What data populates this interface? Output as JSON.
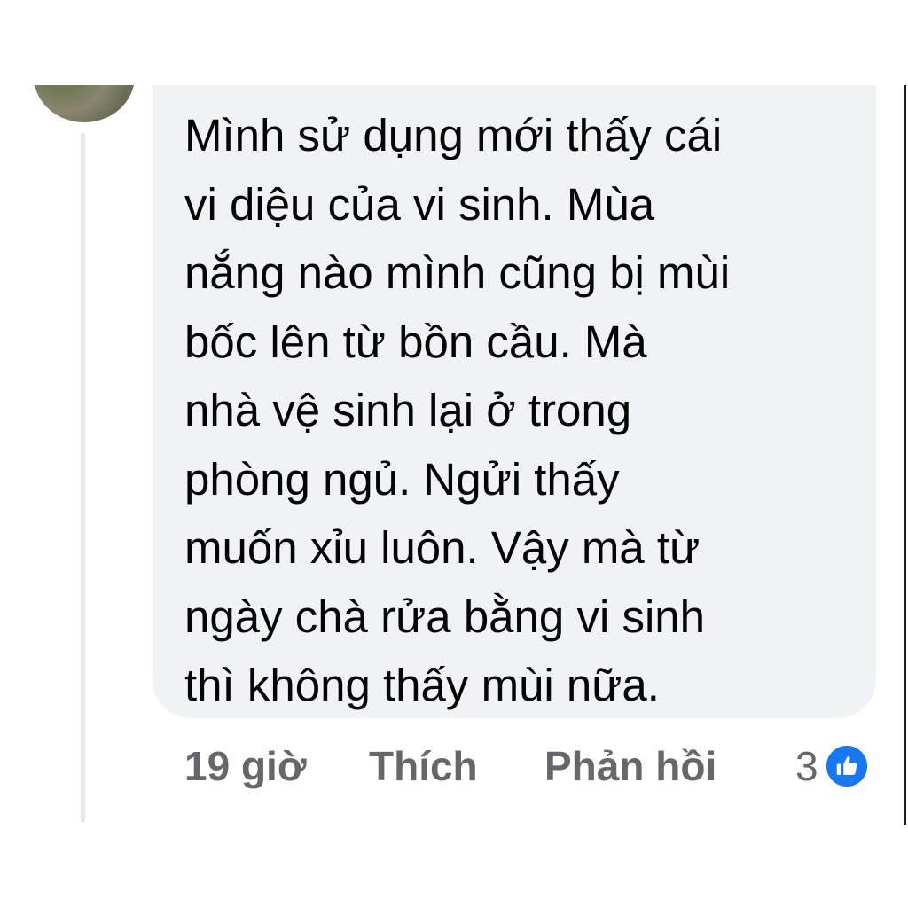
{
  "comment": {
    "lines": [
      "Mình sử dụng mới thấy cái",
      "vi diệu của vi sinh. Mùa",
      "nắng nào mình cũng bị mùi",
      "bốc lên từ bồn cầu. Mà",
      "nhà vệ sinh lại ở trong",
      "phòng ngủ. Ngửi thấy",
      "muốn xỉu luôn. Vậy mà từ",
      "ngày chà rửa bằng vi sinh",
      "thì không thấy mùi nữa."
    ]
  },
  "actions": {
    "time": "19 giờ",
    "like_label": "Thích",
    "reply_label": "Phản hồi"
  },
  "reactions": {
    "count": "3",
    "icon": "like-thumbs-up-icon",
    "icon_color": "#1877f2"
  },
  "colors": {
    "bubble": "#f0f2f5",
    "text": "#050505",
    "secondary_text": "#65676b"
  }
}
